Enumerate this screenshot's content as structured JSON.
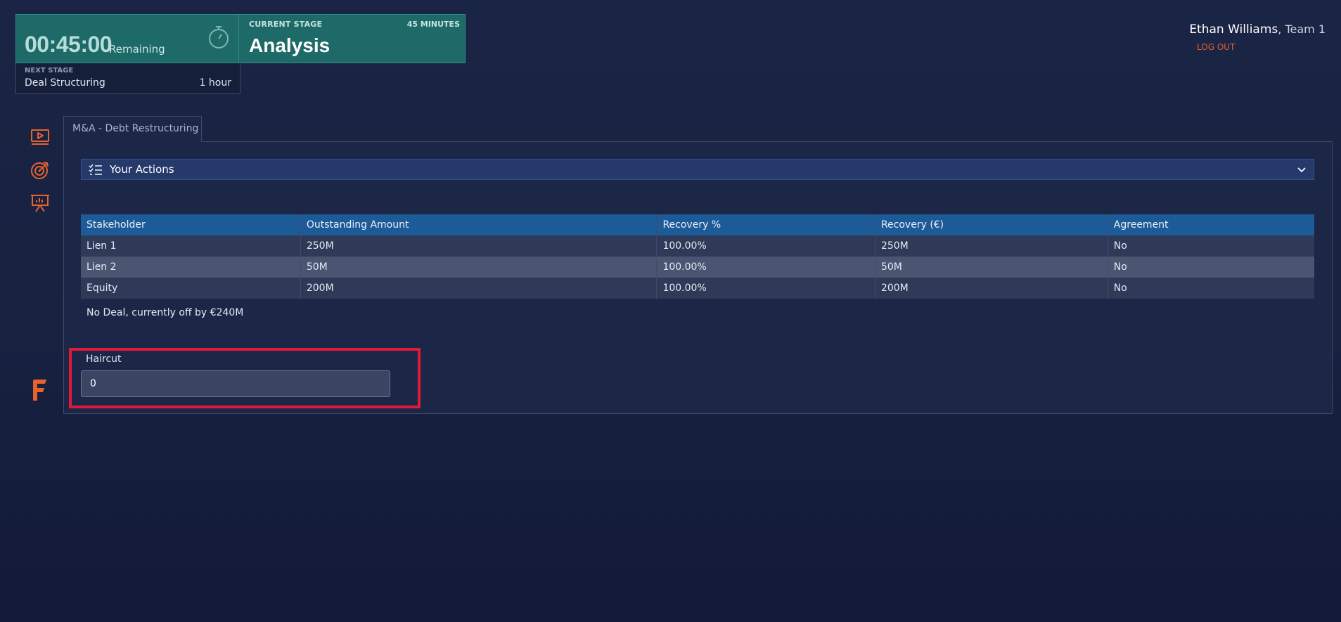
{
  "timer": {
    "value": "00:45:00",
    "remaining_label": "Remaining"
  },
  "current_stage": {
    "label": "CURRENT STAGE",
    "duration": "45 MINUTES",
    "name": "Analysis"
  },
  "next_stage": {
    "label": "NEXT STAGE",
    "name": "Deal Structuring",
    "duration": "1 hour"
  },
  "user": {
    "name": "Ethan Williams",
    "team": ", Team 1",
    "logout_label": "LOG OUT"
  },
  "nav_icons": [
    "video-play-icon",
    "target-icon",
    "presentation-chart-icon"
  ],
  "tab": {
    "label": "M&A - Debt Restructuring"
  },
  "actions": {
    "label": "Your Actions"
  },
  "table": {
    "headers": [
      "Stakeholder",
      "Outstanding Amount",
      "Recovery %",
      "Recovery (€)",
      "Agreement"
    ],
    "rows": [
      [
        "Lien 1",
        "250M",
        "100.00%",
        "250M",
        "No"
      ],
      [
        "Lien 2",
        "50M",
        "100.00%",
        "50M",
        "No"
      ],
      [
        "Equity",
        "200M",
        "100.00%",
        "200M",
        "No"
      ]
    ]
  },
  "deal_status": "No Deal, currently off by €240M",
  "haircut": {
    "label": "Haircut",
    "value": "0"
  },
  "colors": {
    "accent": "#e8622d",
    "timer_bg": "#1d6a68",
    "table_header": "#1d5b98",
    "highlight": "#e3183a"
  }
}
